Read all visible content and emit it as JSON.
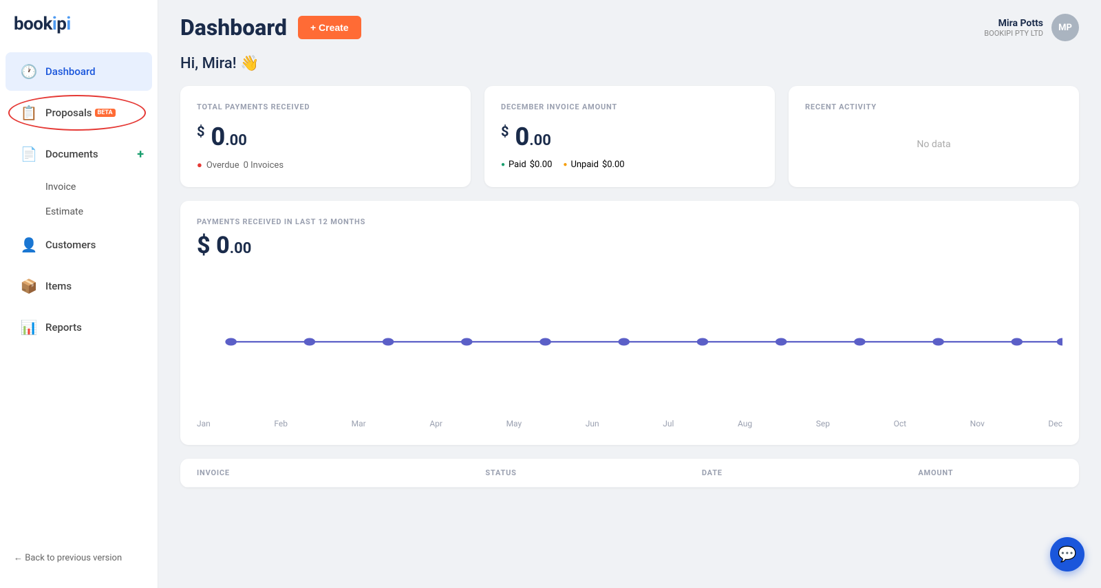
{
  "app": {
    "logo": "bookipi",
    "logo_highlight": "i"
  },
  "sidebar": {
    "items": [
      {
        "id": "dashboard",
        "label": "Dashboard",
        "icon": "🕐",
        "active": true
      },
      {
        "id": "proposals",
        "label": "Proposals",
        "icon": "📋",
        "badge": "BETA",
        "circled": true
      },
      {
        "id": "documents",
        "label": "Documents",
        "icon": "📄",
        "hasAdd": true
      },
      {
        "id": "invoice",
        "label": "Invoice",
        "sub": true
      },
      {
        "id": "estimate",
        "label": "Estimate",
        "sub": true
      },
      {
        "id": "customers",
        "label": "Customers",
        "icon": "👤"
      },
      {
        "id": "items",
        "label": "Items",
        "icon": "📦"
      },
      {
        "id": "reports",
        "label": "Reports",
        "icon": "📊"
      }
    ],
    "footer": "← Back to previous version"
  },
  "header": {
    "title": "Dashboard",
    "create_button": "+ Create",
    "user": {
      "name": "Mira Potts",
      "company": "BOOKIPI PTY LTD",
      "initials": "MP"
    }
  },
  "greeting": "Hi, Mira! 👋",
  "cards": {
    "total_payments": {
      "title": "TOTAL PAYMENTS RECEIVED",
      "amount_main": "0",
      "amount_decimal": ".00",
      "currency": "$",
      "overdue_label": "Overdue",
      "overdue_count": "0 Invoices"
    },
    "december_invoice": {
      "title": "DECEMBER INVOICE AMOUNT",
      "amount_main": "0",
      "amount_decimal": ".00",
      "currency": "$",
      "paid_label": "Paid",
      "paid_amount": "$0.00",
      "unpaid_label": "Unpaid",
      "unpaid_amount": "$0.00"
    },
    "recent_activity": {
      "title": "RECENT ACTIVITY",
      "empty_label": "No data"
    }
  },
  "chart": {
    "title": "PAYMENTS RECEIVED IN LAST 12 MONTHS",
    "amount_main": "0",
    "amount_decimal": ".00",
    "currency": "$",
    "months": [
      "Jan",
      "Feb",
      "Mar",
      "Apr",
      "May",
      "Jun",
      "Jul",
      "Aug",
      "Sep",
      "Oct",
      "Nov",
      "Dec"
    ],
    "values": [
      0,
      0,
      0,
      0,
      0,
      0,
      0,
      0,
      0,
      0,
      0,
      0
    ],
    "color": "#5b5fc7"
  },
  "table": {
    "columns": [
      "INVOICE",
      "STATUS",
      "DATE",
      "AMOUNT"
    ]
  },
  "chat": {
    "icon": "💬"
  }
}
